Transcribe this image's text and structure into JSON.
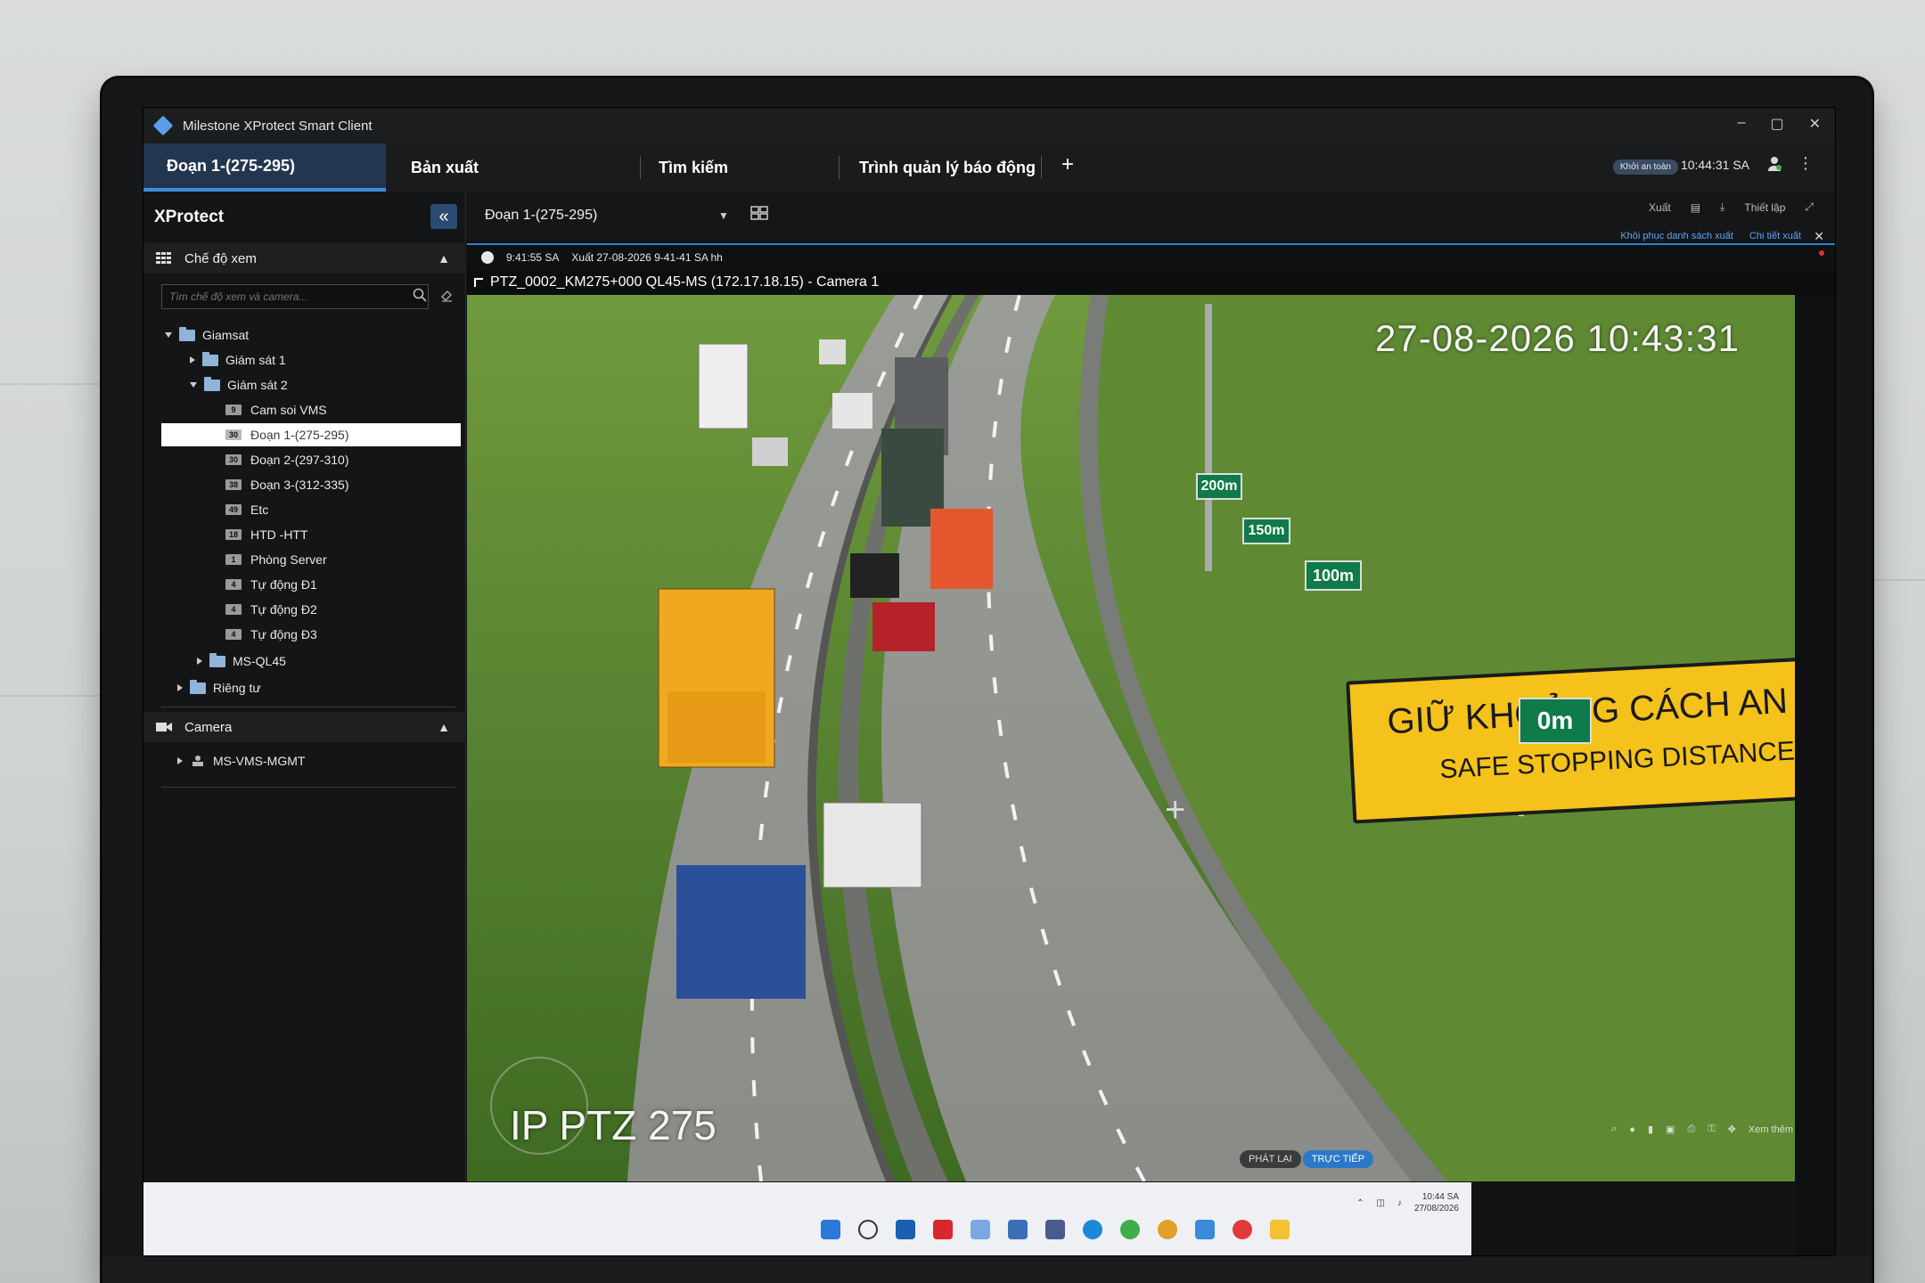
{
  "window": {
    "app_title": "Milestone XProtect Smart Client",
    "controls": [
      "–",
      "▢",
      "✕"
    ]
  },
  "tabs": [
    {
      "label": "Đoạn 1-(275-295)",
      "active": true
    },
    {
      "label": "Bản xuất",
      "active": false
    },
    {
      "label": "Tìm kiếm",
      "active": false
    },
    {
      "label": "Trình quản lý báo động",
      "active": false
    }
  ],
  "tab_add": "+",
  "header": {
    "safe_badge": "Khởi an toàn",
    "time": "10:44:31 SA",
    "menu_glyph": "⋮"
  },
  "sidebar": {
    "title": "XProtect",
    "views_header": "Chế độ xem",
    "search_placeholder": "Tìm chế độ xem và camera...",
    "tree": [
      {
        "label": "Giamsat",
        "level": 0,
        "toggle": "down",
        "type": "folder"
      },
      {
        "label": "Giám sát 1",
        "level": 1,
        "toggle": "right",
        "type": "folder"
      },
      {
        "label": "Giám sát 2",
        "level": 1,
        "toggle": "down",
        "type": "folder"
      },
      {
        "label": "Cam soi VMS",
        "level": 2,
        "badge": "9",
        "type": "view"
      },
      {
        "label": "Đoạn 1-(275-295)",
        "level": 2,
        "badge": "30",
        "type": "view",
        "selected": true
      },
      {
        "label": "Đoạn 2-(297-310)",
        "level": 2,
        "badge": "30",
        "type": "view"
      },
      {
        "label": "Đoạn 3-(312-335)",
        "level": 2,
        "badge": "38",
        "type": "view"
      },
      {
        "label": "Etc",
        "level": 2,
        "badge": "49",
        "type": "view"
      },
      {
        "label": "HTD -HTT",
        "level": 2,
        "badge": "18",
        "type": "view"
      },
      {
        "label": "Phòng Server",
        "level": 2,
        "badge": "1",
        "type": "view"
      },
      {
        "label": "Tự động Đ1",
        "level": 2,
        "badge": "4",
        "type": "view"
      },
      {
        "label": "Tự động Đ2",
        "level": 2,
        "badge": "4",
        "type": "view"
      },
      {
        "label": "Tự động Đ3",
        "level": 2,
        "badge": "4",
        "type": "view"
      },
      {
        "label": "MS-QL45",
        "level": 1,
        "toggle": "right",
        "type": "folder"
      },
      {
        "label": "Riêng tư",
        "level": 0,
        "toggle": "right",
        "type": "folder"
      }
    ],
    "camera_header": "Camera",
    "camera_tree": [
      {
        "label": "MS-VMS-MGMT",
        "toggle": "right"
      }
    ]
  },
  "viewbar": {
    "selected_view": "Đoạn 1-(275-295)",
    "export_label": "Xuất",
    "setup_label": "Thiết lập",
    "restore_link": "Khôi phục danh sách xuất",
    "detail_link": "Chi tiết xuất"
  },
  "status": {
    "time": "9:41:55 SA",
    "export_text": "Xuất 27-08-2026 9-41-41 SA hh"
  },
  "camera": {
    "title": "PTZ_0002_KM275+000 QL45-MS (172.17.18.15) - Camera 1",
    "overlay_timestamp": "27-08-2026 10:43:31",
    "overlay_name": "IP PTZ 275",
    "sign_vn": "GIỮ KHOẢNG CÁCH AN TOÀ",
    "sign_en": "SAFE STOPPING DISTANCE",
    "distance_signs": [
      "200m",
      "150m",
      "100m",
      "0m"
    ],
    "more_label": "Xem thêm"
  },
  "playback": {
    "replay_label": "PHÁT LẠI",
    "live_label": "TRỰC TIẾP"
  },
  "taskbar": {
    "clock_time": "10:44 SA",
    "clock_date": "27/08/2026"
  },
  "colors": {
    "accent": "#3b8fe0",
    "active_tab": "#23364f",
    "sign_yellow": "#f4c21a",
    "dist_green": "#0f7a4a"
  }
}
